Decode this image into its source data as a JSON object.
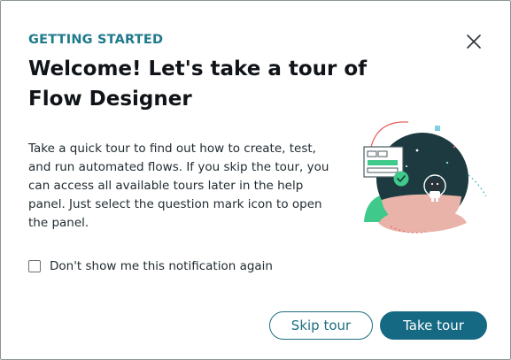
{
  "dialog": {
    "eyebrow": "GETTING STARTED",
    "title": "Welcome! Let's take a tour of Flow Designer",
    "description": "Take a quick tour to find out how to create, test, and run automated flows. If you skip the tour, you can access all available tours later in the help panel. Just select the question mark icon to open the panel.",
    "checkbox_label": "Don't show me this notification again",
    "checkbox_checked": false,
    "skip_label": "Skip tour",
    "take_label": "Take tour",
    "close_icon": "close-icon",
    "illustration_icon": "astronaut-cat-illustration"
  },
  "colors": {
    "accent": "#1f7a8c",
    "primary_button": "#156983",
    "planet": "#1c3a3f",
    "green": "#3fc98a",
    "pink": "#e9b3aa",
    "coral": "#e85d5d"
  }
}
